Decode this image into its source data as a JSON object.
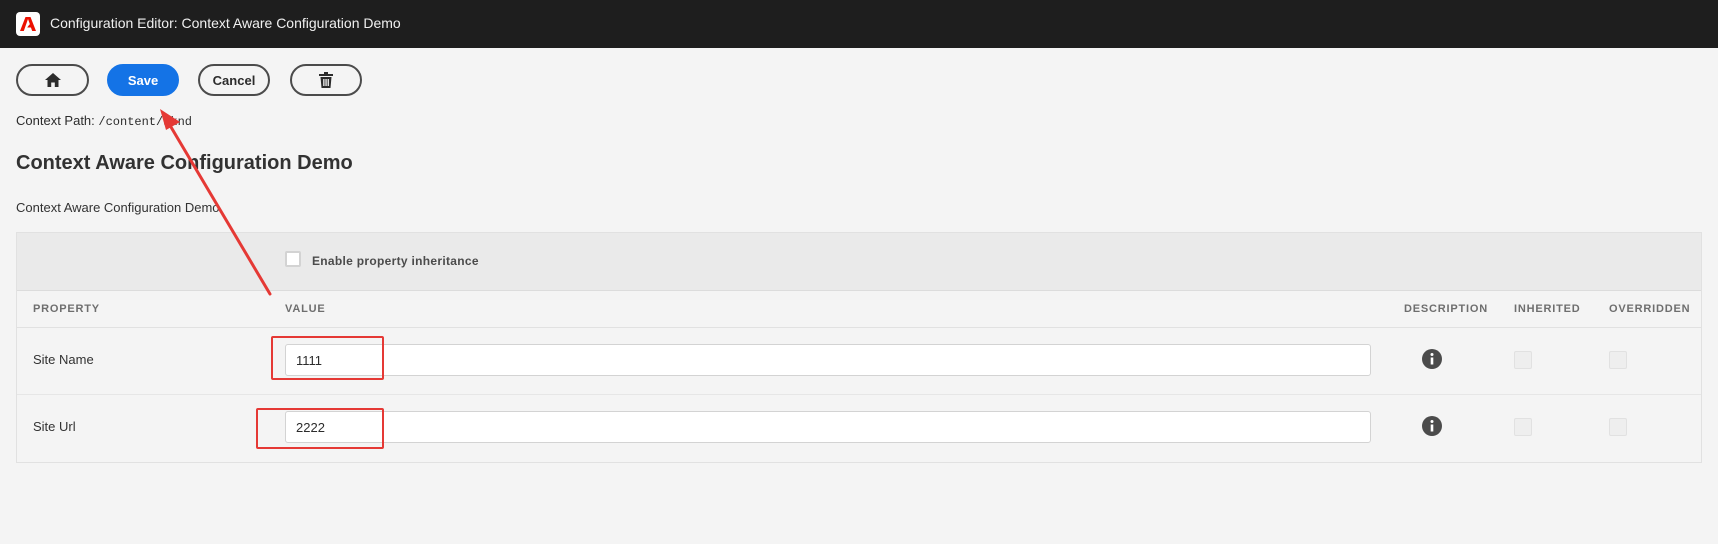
{
  "window": {
    "title": "Configuration Editor: Context Aware Configuration Demo"
  },
  "toolbar": {
    "home_icon": "home-icon",
    "save_label": "Save",
    "cancel_label": "Cancel",
    "delete_icon": "trash-icon"
  },
  "context": {
    "label": "Context Path: ",
    "path": "/content/wknd"
  },
  "page": {
    "title": "Context Aware Configuration Demo",
    "description": "Context Aware Configuration Demo"
  },
  "table": {
    "inherit_label": "Enable property inheritance",
    "columns": {
      "property": "PROPERTY",
      "value": "VALUE",
      "description": "DESCRIPTION",
      "inherited": "INHERITED",
      "overridden": "OVERRIDDEN"
    },
    "rows": [
      {
        "property": "Site Name",
        "value": "1111",
        "description_icon": "info-icon"
      },
      {
        "property": "Site Url",
        "value": "2222",
        "description_icon": "info-icon"
      }
    ]
  },
  "colors": {
    "accent": "#1473e6",
    "topbar": "#1e1e1e",
    "annotation": "#e53935"
  }
}
